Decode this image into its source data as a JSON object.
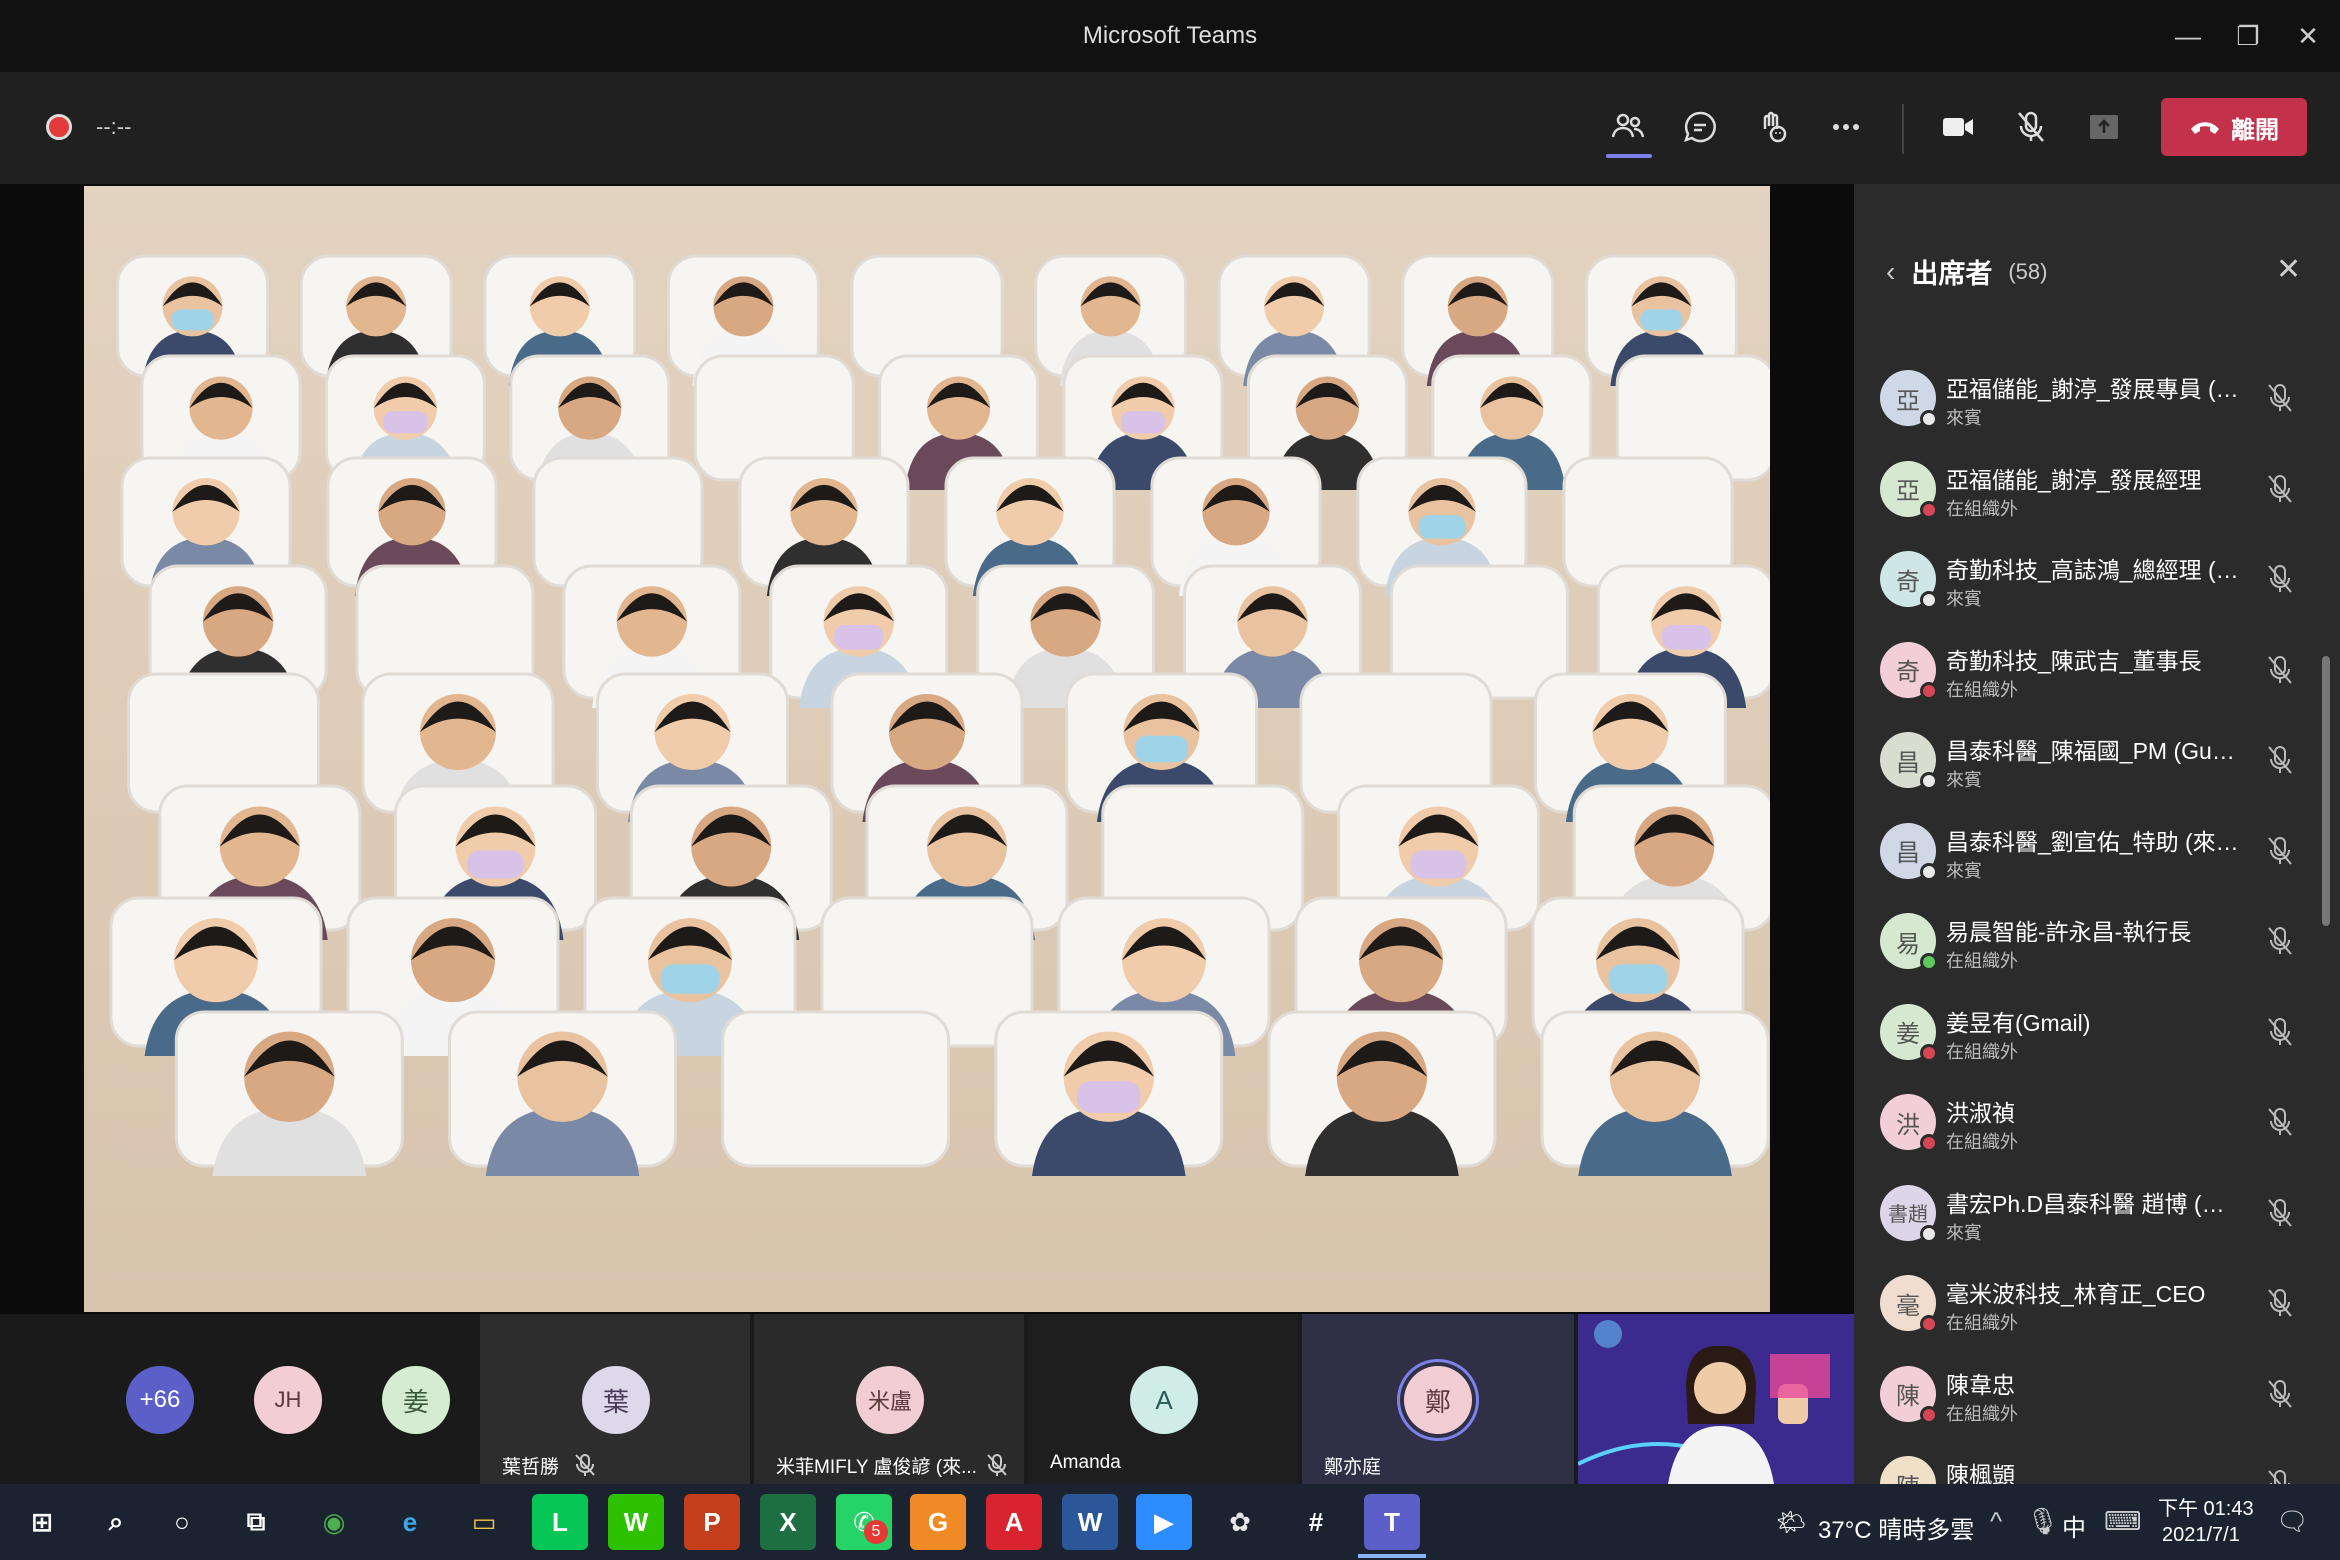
{
  "window": {
    "title": "Microsoft Teams",
    "minimize": "—",
    "restore": "❐",
    "close": "✕"
  },
  "toolbar": {
    "timer": "--:--",
    "leave_label": "離開"
  },
  "panel": {
    "title": "出席者",
    "count": "(58)",
    "participants": [
      {
        "avatar": "亞",
        "name": "亞福儲能_謝渟_發展專員 (來賓)",
        "role": "來賓",
        "color": "#cfd8e6"
      },
      {
        "avatar": "亞",
        "name": "亞福儲能_謝渟_發展經理",
        "role": "在組織外",
        "color": "#d6e8d0"
      },
      {
        "avatar": "奇",
        "name": "奇勤科技_高誌鴻_總經理 (來賓)",
        "role": "來賓",
        "color": "#cfe6e6"
      },
      {
        "avatar": "奇",
        "name": "奇勤科技_陳武吉_董事長",
        "role": "在組織外",
        "color": "#f2cfd8"
      },
      {
        "avatar": "昌",
        "name": "昌泰科醫_陳福國_PM (Guest) ...",
        "role": "來賓",
        "color": "#d8ddd0"
      },
      {
        "avatar": "昌",
        "name": "昌泰科醫_劉宣佑_特助 (來賓)",
        "role": "來賓",
        "color": "#d0d8e6"
      },
      {
        "avatar": "易",
        "name": "易晨智能-許永昌-執行長",
        "role": "在組織外",
        "color": "#d6e8d0"
      },
      {
        "avatar": "姜",
        "name": "姜昱有(Gmail)",
        "role": "在組織外",
        "color": "#d6e8d0"
      },
      {
        "avatar": "洪",
        "name": "洪淑禎",
        "role": "在組織外",
        "color": "#f2cfd8"
      },
      {
        "avatar": "書趙",
        "name": "書宏Ph.D昌泰科醫 趙博 (來賓)",
        "role": "來賓",
        "color": "#ddd6e8"
      },
      {
        "avatar": "毫",
        "name": "毫米波科技_林育正_CEO",
        "role": "在組織外",
        "color": "#f0ddd0"
      },
      {
        "avatar": "陳",
        "name": "陳韋忠",
        "role": "在組織外",
        "color": "#f2cfd8"
      },
      {
        "avatar": "陳",
        "name": "陳楓顗",
        "role": "",
        "color": "#f0e0c8"
      }
    ]
  },
  "strip": {
    "overflow": "+66",
    "tiles": [
      {
        "initials": "JH",
        "name": ""
      },
      {
        "initials": "姜",
        "name": ""
      },
      {
        "initials": "葉",
        "name": "葉哲勝"
      },
      {
        "initials": "米盧",
        "name": "米菲MIFLY 盧俊諺 (來..."
      },
      {
        "initials": "A",
        "name": "Amanda"
      },
      {
        "initials": "鄭",
        "name": "鄭亦庭"
      }
    ]
  },
  "taskbar": {
    "weather": "37°C 晴時多雲",
    "ime": "中",
    "time": "下午 01:43",
    "date": "2021/7/1",
    "whatsapp_badge": "5"
  }
}
